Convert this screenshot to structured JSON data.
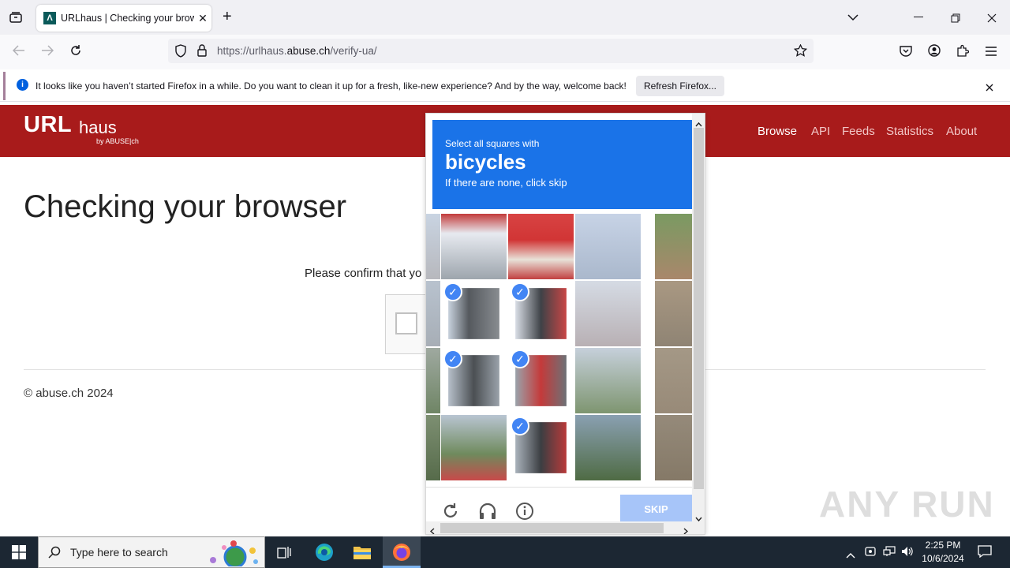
{
  "browser": {
    "tab_title": "URLhaus | Checking your brow",
    "tab_close": "✕",
    "new_tab": "+",
    "url_prefix": "https://urlhaus.",
    "url_domain": "abuse.ch",
    "url_path": "/verify-ua/",
    "notification": "It looks like you haven’t started Firefox in a while. Do you want to clean it up for a fresh, like-new experience? And by the way, welcome back!",
    "refresh_button": "Refresh Firefox..."
  },
  "site": {
    "logo_main": "URL",
    "logo_sub": "haus",
    "logo_by": "by ABUSE|ch",
    "nav": [
      "Browse",
      "API",
      "Feeds",
      "Statistics",
      "About"
    ],
    "heading": "Checking your browser",
    "confirm_text": "Please confirm that yo",
    "footer": "© abuse.ch 2024"
  },
  "captcha": {
    "line1": "Select all squares with",
    "target": "bicycles",
    "line3": "If there are none, click skip",
    "skip": "SKIP",
    "selected_tiles": [
      "r2c1",
      "r2c2",
      "r3c1",
      "r3c2",
      "r4c2"
    ]
  },
  "taskbar": {
    "search_placeholder": "Type here to search",
    "time": "2:25 PM",
    "date": "10/6/2024"
  },
  "watermark": "ANY RUN",
  "colors": {
    "header_red": "#a81b1b",
    "captcha_blue": "#1a73e8",
    "taskbar": "#1c2733"
  }
}
